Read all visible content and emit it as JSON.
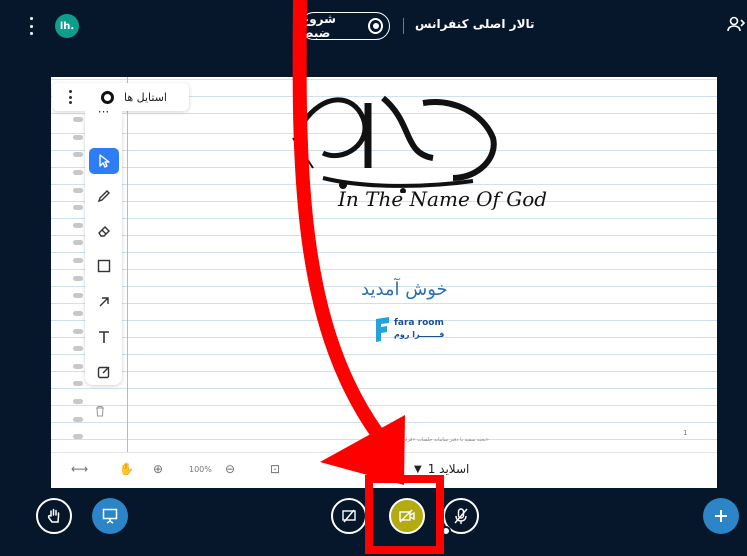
{
  "topbar": {
    "app_logo_text": "lh.",
    "record_label": "شروع ضبط",
    "room_title": "تالار اصلی کنفرانس"
  },
  "style_bar": {
    "label": "استایل ها"
  },
  "whiteboard": {
    "tools": [
      "select-icon",
      "pencil-icon",
      "eraser-icon",
      "rectangle-icon",
      "arrow-icon",
      "text-icon",
      "note-icon"
    ],
    "active_tool": "select-icon"
  },
  "slide": {
    "english_text": "In The Name Of God",
    "welcome_text": "خوش آمدید",
    "logo_en": "fara room",
    "logo_fa": "فـــــــرا روم",
    "footer_text": "تخته سفید یا دفتر سامانه جلسات «فرارو»",
    "page_number": "1"
  },
  "slide_controls": {
    "zoom": "100%",
    "current_slide": "اسلاید 1"
  },
  "annotation": {
    "color": "#ff0000"
  },
  "colors": {
    "background": "#06172b",
    "accent_blue": "#2b85c7",
    "camera_active": "#b3ab10"
  }
}
